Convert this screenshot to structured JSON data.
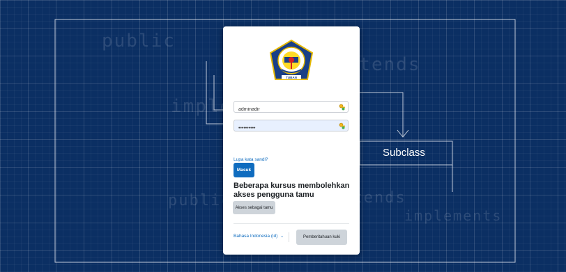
{
  "background": {
    "words": [
      "public",
      "extends",
      "implements",
      "public",
      "extends",
      "implements"
    ],
    "subclass_label": "Subclass"
  },
  "login": {
    "logo": {
      "text_top": "Sekolah Menengah Kejuruan",
      "text_mid": "JATIROGO",
      "text_bottom": "TUBAN"
    },
    "username_value": "adminadir",
    "password_value": "••••••••••",
    "submit_label": "Masuk",
    "forgot_link": "Lupa kata sandi?",
    "guest_heading": "Beberapa kursus membolehkan akses pengguna tamu",
    "guest_button": "Akses sebagai tamu",
    "language_selector": "Bahasa Indonesia (id)",
    "cookie_button": "Pemberitahuan kuki"
  },
  "colors": {
    "background": "#0b2f63",
    "primary": "#0f6cbf",
    "secondary_button": "#ced4da"
  }
}
